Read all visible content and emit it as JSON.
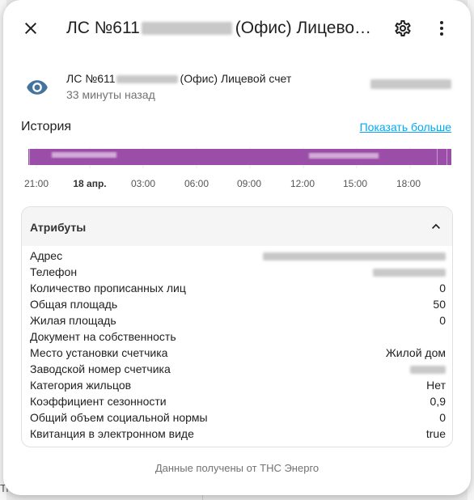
{
  "background": {
    "bottom_text": "Ti"
  },
  "header": {
    "title_prefix": "ЛС №611",
    "title_suffix": "(Офис) Лицевой счет",
    "close_icon": "close-icon",
    "settings_icon": "gear-icon",
    "more_icon": "more-vertical-icon"
  },
  "entity": {
    "name_prefix": "ЛС №611",
    "name_suffix": "(Офис) Лицевой счет",
    "last_changed": "33 минуты назад",
    "icon": "eye-icon",
    "icon_color": "#44739e"
  },
  "history": {
    "title": "История",
    "show_more": "Показать больше",
    "bar_color": "#9b4ea8",
    "ticks": [
      "21:00",
      "18 апр.",
      "03:00",
      "06:00",
      "09:00",
      "12:00",
      "15:00",
      "18:00"
    ]
  },
  "attributes": {
    "title": "Атрибуты",
    "rows": [
      {
        "key": "Адрес",
        "value": "",
        "blurred": true
      },
      {
        "key": "Телефон",
        "value": "",
        "blurred": true
      },
      {
        "key": "Количество прописанных лиц",
        "value": "0",
        "blurred": false
      },
      {
        "key": "Общая площадь",
        "value": "50",
        "blurred": false
      },
      {
        "key": "Жилая площадь",
        "value": "0",
        "blurred": false
      },
      {
        "key": "Документ на собственность",
        "value": "",
        "blurred": false
      },
      {
        "key": "Место установки счетчика",
        "value": "Жилой дом",
        "blurred": false
      },
      {
        "key": "Заводской номер счетчика",
        "value": "",
        "blurred": true
      },
      {
        "key": "Категория жильцов",
        "value": "Нет",
        "blurred": false
      },
      {
        "key": "Коэффициент сезонности",
        "value": "0,9",
        "blurred": false
      },
      {
        "key": "Общий объем социальной нормы",
        "value": "0",
        "blurred": false
      },
      {
        "key": "Квитанция в электронном виде",
        "value": "true",
        "blurred": false
      }
    ]
  },
  "footer": {
    "attribution": "Данные получены от ТНС Энерго"
  }
}
